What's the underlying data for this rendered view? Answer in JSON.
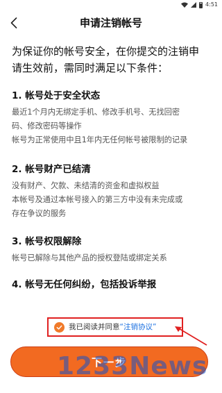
{
  "status_bar": {
    "time": "4:51"
  },
  "nav": {
    "title": "申请注销帐号"
  },
  "intro": {
    "line1": "为保证你的帐号安全，在你提交的注销申",
    "line2": "请生效前，需同时满足以下条件："
  },
  "sections": [
    {
      "title": "1. 帐号处于安全状态",
      "lines": [
        "最近1个月内无绑定手机、修改手机号、无找回密",
        "码、修改密码等操作",
        "帐号为正常使用中且1年内无任何帐号被限制的记录"
      ]
    },
    {
      "title": "2. 帐号财产已结清",
      "lines": [
        "没有财产、欠款、未结清的资金和虚拟权益",
        "本帐号及通过本帐号接入的第三方中没有未完成或",
        "存在争议的服务"
      ]
    },
    {
      "title": "3. 帐号权限解除",
      "lines": [
        "帐号已解除与其他产品的授权登陆或绑定关系"
      ]
    },
    {
      "title": "4. 帐号无任何纠纷，包括投诉举报",
      "lines": []
    }
  ],
  "agreement": {
    "prefix": "我已阅读并同意",
    "link": "“注销协议”",
    "checked": true
  },
  "next_button": {
    "label": "下一步"
  },
  "watermark": {
    "text": "1233News"
  },
  "colors": {
    "accent": "#f26a21",
    "link": "#1a6fe0",
    "annotation": "#e02020"
  }
}
